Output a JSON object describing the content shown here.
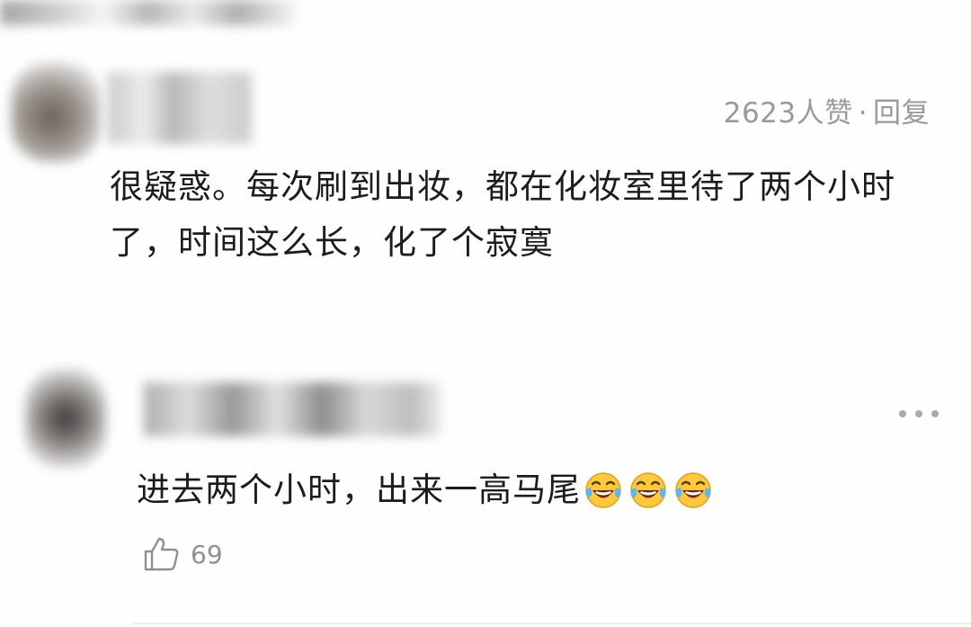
{
  "comment_1": {
    "like_count_text": "2623人赞",
    "separator": "·",
    "reply_label": "回复",
    "text": "很疑惑。每次刷到出妆，都在化妆室里待了两个小时了，时间这么长，化了个寂寞"
  },
  "comment_2": {
    "text": "进去两个小时，出来一高马尾",
    "emojis": [
      "laughing-tears",
      "laughing-tears",
      "laughing-tears"
    ],
    "likes": "69"
  },
  "icons": {
    "more": "more-horizontal-icon",
    "like": "thumbs-up-icon",
    "emoji": "laughing-tears-emoji"
  }
}
